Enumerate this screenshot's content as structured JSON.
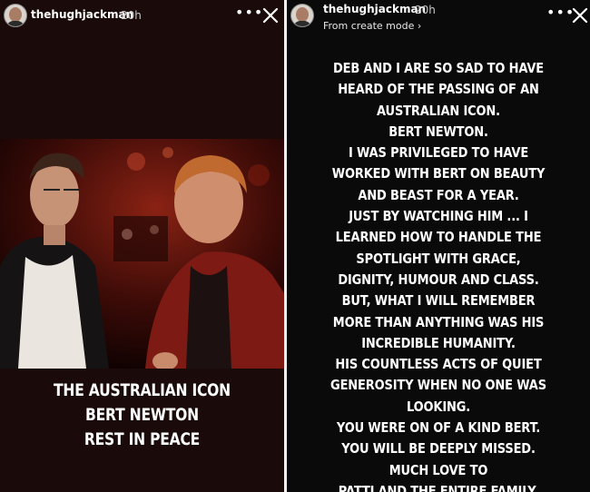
{
  "left_story": {
    "username": "thehughjackman",
    "time": "20h",
    "more_icon": "more-horizontal-icon",
    "close_icon": "close-icon",
    "caption_lines": [
      "THE AUSTRALIAN ICON",
      "BERT NEWTON",
      "REST IN PEACE"
    ]
  },
  "right_story": {
    "username": "thehughjackman",
    "time": "20h",
    "mode_label": "From create mode",
    "mode_chevron": "›",
    "more_icon": "more-horizontal-icon",
    "close_icon": "close-icon",
    "text_lines": [
      "DEB AND I ARE SO SAD TO HAVE",
      "HEARD OF THE PASSING OF AN",
      "AUSTRALIAN ICON.",
      "BERT NEWTON.",
      "I WAS PRIVILEGED TO HAVE",
      "WORKED WITH BERT ON BEAUTY",
      "AND BEAST FOR A YEAR.",
      "JUST BY WATCHING HIM ... I",
      "LEARNED HOW TO HANDLE THE",
      "SPOTLIGHT WITH GRACE,",
      "DIGNITY, HUMOUR AND CLASS.",
      "BUT,  WHAT I WILL REMEMBER",
      "MORE THAN ANYTHING WAS HIS",
      "INCREDIBLE HUMANITY.",
      "HIS COUNTLESS ACTS OF QUIET",
      "GENEROSITY WHEN NO ONE WAS",
      "LOOKING.",
      "YOU WERE ON OF A KIND BERT.",
      "YOU WILL BE DEEPLY MISSED.",
      "MUCH LOVE TO",
      "PATTI AND THE ENTIRE FAMILY."
    ]
  },
  "colors": {
    "background": "#0a0a0a",
    "divider": "#f2f2f2",
    "text": "#ffffff"
  }
}
